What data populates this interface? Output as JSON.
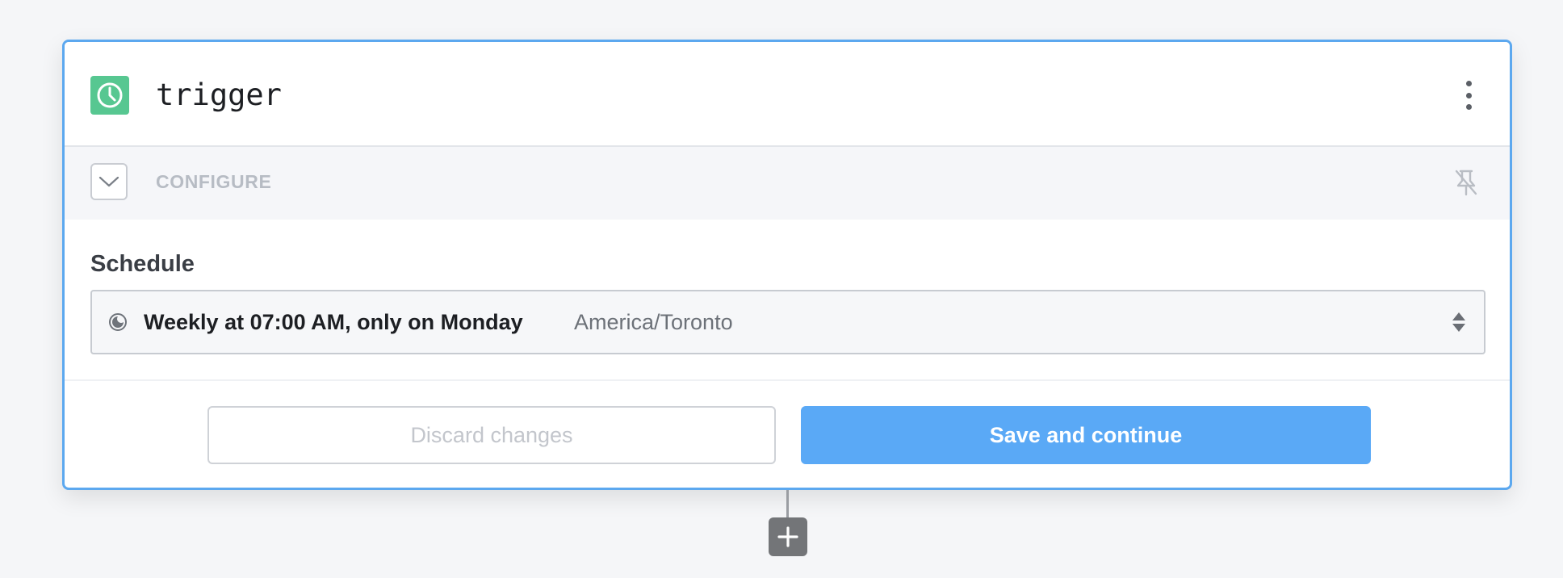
{
  "step": {
    "title": "trigger",
    "icon": "clock-icon",
    "icon_color": "#57c791",
    "menu_icon": "more-vertical-icon"
  },
  "configure": {
    "label": "CONFIGURE",
    "collapse_icon": "chevron-down-icon",
    "pin_icon": "pin-off-icon"
  },
  "schedule": {
    "label": "Schedule",
    "value": "Weekly at 07:00 AM, only on Monday",
    "timezone": "America/Toronto",
    "icon": "schedule-moon-icon",
    "select_icon": "sort-arrows-icon"
  },
  "actions": {
    "discard_label": "Discard changes",
    "save_label": "Save and continue"
  },
  "add_step": {
    "icon": "plus-icon"
  },
  "colors": {
    "accent": "#5aa9f6",
    "card_border": "#5ca8ef",
    "add_button": "#737578"
  }
}
